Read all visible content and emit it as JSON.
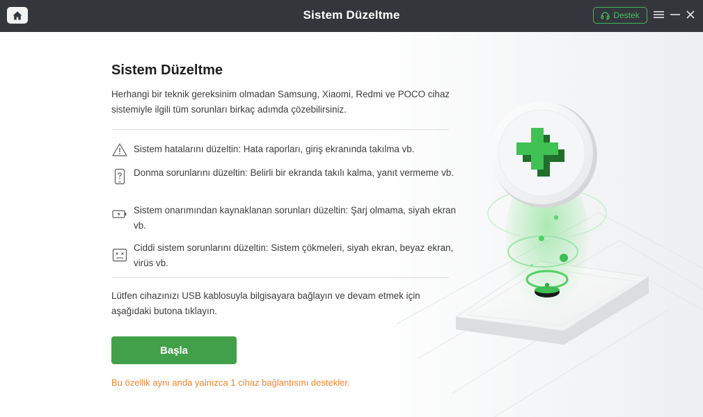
{
  "titlebar": {
    "title": "Sistem Düzeltme",
    "support_label": "Destek"
  },
  "icons": {
    "home": "home-icon",
    "support": "headset-icon",
    "menu": "hamburger-menu-icon",
    "minimize": "minimize-icon",
    "close": "close-icon"
  },
  "main": {
    "heading": "Sistem Düzeltme",
    "intro": "Herhangi bir teknik gereksinim olmadan Samsung, Xiaomi, Redmi ve POCO cihaz sistemiyle ilgili tüm sorunları birkaç adımda çözebilirsiniz.",
    "features": [
      {
        "icon": "warning-icon",
        "text": "Sistem hatalarını düzeltin: Hata raporları, giriş ekranında takılma vb."
      },
      {
        "icon": "frozen-phone-question-icon",
        "text": "Donma sorunlarını düzeltin: Belirli bir ekranda takılı kalma, yanıt vermeme vb."
      },
      {
        "icon": "charging-battery-icon",
        "text": "Sistem onarımından kaynaklanan sorunları düzeltin: Şarj olmama, siyah ekran vb."
      },
      {
        "icon": "crashed-screen-icon",
        "text": "Ciddi sistem sorunlarını düzeltin: Sistem çökmeleri, siyah ekran, beyaz ekran, virüs vb."
      }
    ],
    "instruction": "Lütfen cihazınızı USB kablosuyla bilgisayara bağlayın ve devam etmek için aşağıdaki butona tıklayın.",
    "start_label": "Başla",
    "note": "Bu özellik aynı anda yalnızca 1 cihaz bağlantısını destekler."
  },
  "colors": {
    "titlebar": "#33373c",
    "accent_green": "#43a04a",
    "support_green": "#45c45f",
    "note_orange": "#ef8630"
  }
}
